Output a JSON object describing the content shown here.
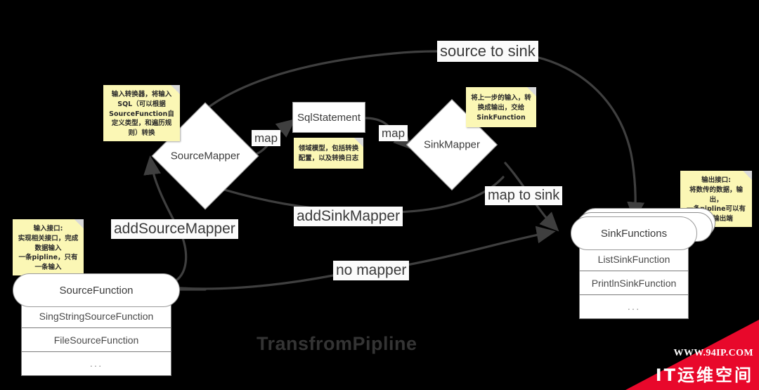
{
  "diagram": {
    "title": "TransfromPipline",
    "nodes": {
      "source_function": {
        "header": "SourceFunction",
        "rows": [
          "SingStringSourceFunction",
          "FileSourceFunction",
          "..."
        ]
      },
      "sink_functions": {
        "header": "SinkFunctions",
        "rows": [
          "ListSinkFunction",
          "PrintlnSinkFunction",
          "..."
        ]
      },
      "source_mapper": {
        "label": "SourceMapper"
      },
      "sink_mapper": {
        "label": "SinkMapper"
      },
      "sql_statement": {
        "label": "SqlStatement"
      }
    },
    "edge_labels": {
      "source_to_sink": "source to sink",
      "map_left": "map",
      "map_right": "map",
      "map_to_sink": "map to sink",
      "add_source_mapper": "addSourceMapper",
      "add_sink_mapper": "addSinkMapper",
      "no_mapper": "no mapper"
    },
    "notes": {
      "source_input": "输入接口:\n实现相关接口，完成\n数据输入\n一条pipline，只有\n一条输入",
      "source_mapper": "输入转换器，将输入\nSQL（可以根据\nSourceFunction自\n定义类型，和遍历规\n则）转换",
      "sql_statement": "领域模型，包括转换\n配置，以及转换日志",
      "sink_mapper": "将上一步的输入，转\n换成输出，交给\nSinkFunction",
      "sink_output": "输出接口:\n将数传的数据，输\n出，\n一条pipline可以有\n多个输出端"
    },
    "watermark": {
      "url": "WWW.94IP.COM",
      "brand": "IT运维空间"
    },
    "colors": {
      "background": "#000000",
      "node_fill": "#ffffff",
      "node_stroke": "#9a9a9a",
      "sticky_fill": "#fbf7b5",
      "edge_stroke": "#3f3f3f",
      "label_fill": "#fbfbfb",
      "watermark_red": "#e8082b"
    }
  }
}
